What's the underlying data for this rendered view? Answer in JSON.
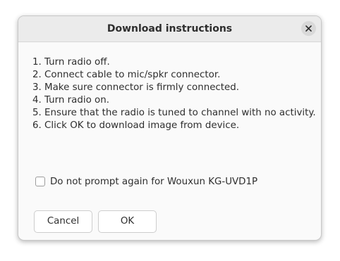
{
  "dialog": {
    "title": "Download instructions",
    "close_icon": "close-icon",
    "instructions": [
      "1. Turn radio off.",
      "2. Connect cable to mic/spkr connector.",
      "3. Make sure connector is firmly connected.",
      "4. Turn radio on.",
      "5. Ensure that the radio is tuned to channel with no activity.",
      "6. Click OK to download image from device."
    ],
    "checkbox": {
      "label": "Do not prompt again for Wouxun KG-UVD1P",
      "checked": false
    },
    "buttons": {
      "cancel_label": "Cancel",
      "ok_label": "OK"
    }
  }
}
